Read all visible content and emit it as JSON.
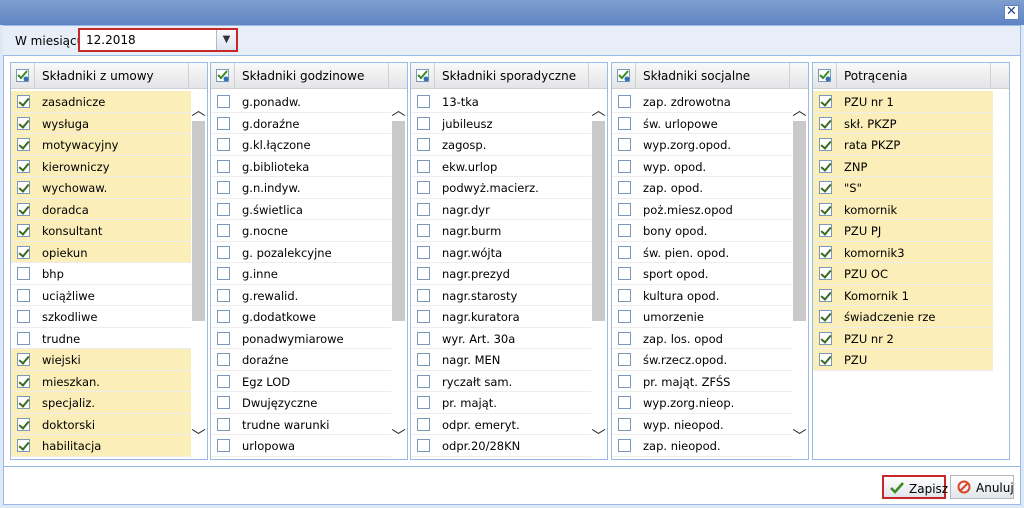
{
  "window": {
    "close_glyph": "✕"
  },
  "month": {
    "label": "W miesiącu:",
    "value": "12.2018"
  },
  "groups": [
    {
      "title": "Składniki z umowy",
      "items": [
        {
          "label": "zasadnicze",
          "checked": true
        },
        {
          "label": "wysługa",
          "checked": true
        },
        {
          "label": "motywacyjny",
          "checked": true
        },
        {
          "label": "kierowniczy",
          "checked": true
        },
        {
          "label": "wychowaw.",
          "checked": true
        },
        {
          "label": "doradca",
          "checked": true
        },
        {
          "label": "konsultant",
          "checked": true
        },
        {
          "label": "opiekun",
          "checked": true
        },
        {
          "label": "bhp",
          "checked": false
        },
        {
          "label": "uciążliwe",
          "checked": false
        },
        {
          "label": "szkodliwe",
          "checked": false
        },
        {
          "label": "trudne",
          "checked": false
        },
        {
          "label": "wiejski",
          "checked": true
        },
        {
          "label": "mieszkan.",
          "checked": true
        },
        {
          "label": "specjaliz.",
          "checked": true
        },
        {
          "label": "doktorski",
          "checked": true
        },
        {
          "label": "habilitacja",
          "checked": true
        }
      ],
      "scrollbar": true
    },
    {
      "title": "Składniki godzinowe",
      "items": [
        {
          "label": "g.ponadw.",
          "checked": false
        },
        {
          "label": "g.doraźne",
          "checked": false
        },
        {
          "label": "g.kl.łączone",
          "checked": false
        },
        {
          "label": "g.biblioteka",
          "checked": false
        },
        {
          "label": "g.n.indyw.",
          "checked": false
        },
        {
          "label": "g.świetlica",
          "checked": false
        },
        {
          "label": "g.nocne",
          "checked": false
        },
        {
          "label": "g. pozalekcyjne",
          "checked": false
        },
        {
          "label": "g.inne",
          "checked": false
        },
        {
          "label": "g.rewalid.",
          "checked": false
        },
        {
          "label": "g.dodatkowe",
          "checked": false
        },
        {
          "label": "ponadwymiarowe",
          "checked": false
        },
        {
          "label": "doraźne",
          "checked": false
        },
        {
          "label": "Egz LOD",
          "checked": false
        },
        {
          "label": "Dwujęzyczne",
          "checked": false
        },
        {
          "label": "trudne warunki",
          "checked": false
        },
        {
          "label": "urlopowa",
          "checked": false
        }
      ],
      "scrollbar": true
    },
    {
      "title": "Składniki sporadyczne",
      "items": [
        {
          "label": "13-tka",
          "checked": false
        },
        {
          "label": "jubileusz",
          "checked": false
        },
        {
          "label": "zagosp.",
          "checked": false
        },
        {
          "label": "ekw.urlop",
          "checked": false
        },
        {
          "label": "podwyż.macierz.",
          "checked": false
        },
        {
          "label": "nagr.dyr",
          "checked": false
        },
        {
          "label": "nagr.burm",
          "checked": false
        },
        {
          "label": "nagr.wójta",
          "checked": false
        },
        {
          "label": "nagr.prezyd",
          "checked": false
        },
        {
          "label": "nagr.starosty",
          "checked": false
        },
        {
          "label": "nagr.kuratora",
          "checked": false
        },
        {
          "label": "wyr. Art. 30a",
          "checked": false
        },
        {
          "label": "nagr. MEN",
          "checked": false
        },
        {
          "label": "ryczałt sam.",
          "checked": false
        },
        {
          "label": "pr. mająt.",
          "checked": false
        },
        {
          "label": "odpr. emeryt.",
          "checked": false
        },
        {
          "label": "odpr.20/28KN",
          "checked": false
        }
      ],
      "scrollbar": true
    },
    {
      "title": "Składniki socjalne",
      "items": [
        {
          "label": "zap. zdrowotna",
          "checked": false
        },
        {
          "label": "św. urlopowe",
          "checked": false
        },
        {
          "label": "wyp.zorg.opod.",
          "checked": false
        },
        {
          "label": "wyp. opod.",
          "checked": false
        },
        {
          "label": "zap. opod.",
          "checked": false
        },
        {
          "label": "poż.miesz.opod",
          "checked": false
        },
        {
          "label": "bony opod.",
          "checked": false
        },
        {
          "label": "św. pien. opod.",
          "checked": false
        },
        {
          "label": "sport opod.",
          "checked": false
        },
        {
          "label": "kultura opod.",
          "checked": false
        },
        {
          "label": "umorzenie",
          "checked": false
        },
        {
          "label": "zap. los. opod",
          "checked": false
        },
        {
          "label": "św.rzecz.opod.",
          "checked": false
        },
        {
          "label": "pr. mająt. ZFŚS",
          "checked": false
        },
        {
          "label": "wyp.zorg.nieop.",
          "checked": false
        },
        {
          "label": "wyp. nieopod.",
          "checked": false
        },
        {
          "label": "zap. nieopod.",
          "checked": false
        }
      ],
      "scrollbar": true
    },
    {
      "title": "Potrącenia",
      "items": [
        {
          "label": "PZU nr 1",
          "checked": true
        },
        {
          "label": "skł. PKZP",
          "checked": true
        },
        {
          "label": "rata PKZP",
          "checked": true
        },
        {
          "label": "ZNP",
          "checked": true
        },
        {
          "label": "\"S\"",
          "checked": true
        },
        {
          "label": "komornik",
          "checked": true
        },
        {
          "label": "PZU PJ",
          "checked": true
        },
        {
          "label": "komornik3",
          "checked": true
        },
        {
          "label": "PZU OC",
          "checked": true
        },
        {
          "label": "Komornik 1",
          "checked": true
        },
        {
          "label": "świadczenie rze",
          "checked": true
        },
        {
          "label": "PZU nr 2",
          "checked": true
        },
        {
          "label": "PZU",
          "checked": true
        }
      ],
      "scrollbar": false
    }
  ],
  "buttons": {
    "save": "Zapisz",
    "cancel": "Anuluj"
  },
  "colors": {
    "accent_border": "#c62828",
    "checked_row_bg": "#fbeeb8",
    "panel_border": "#99bbe8"
  }
}
